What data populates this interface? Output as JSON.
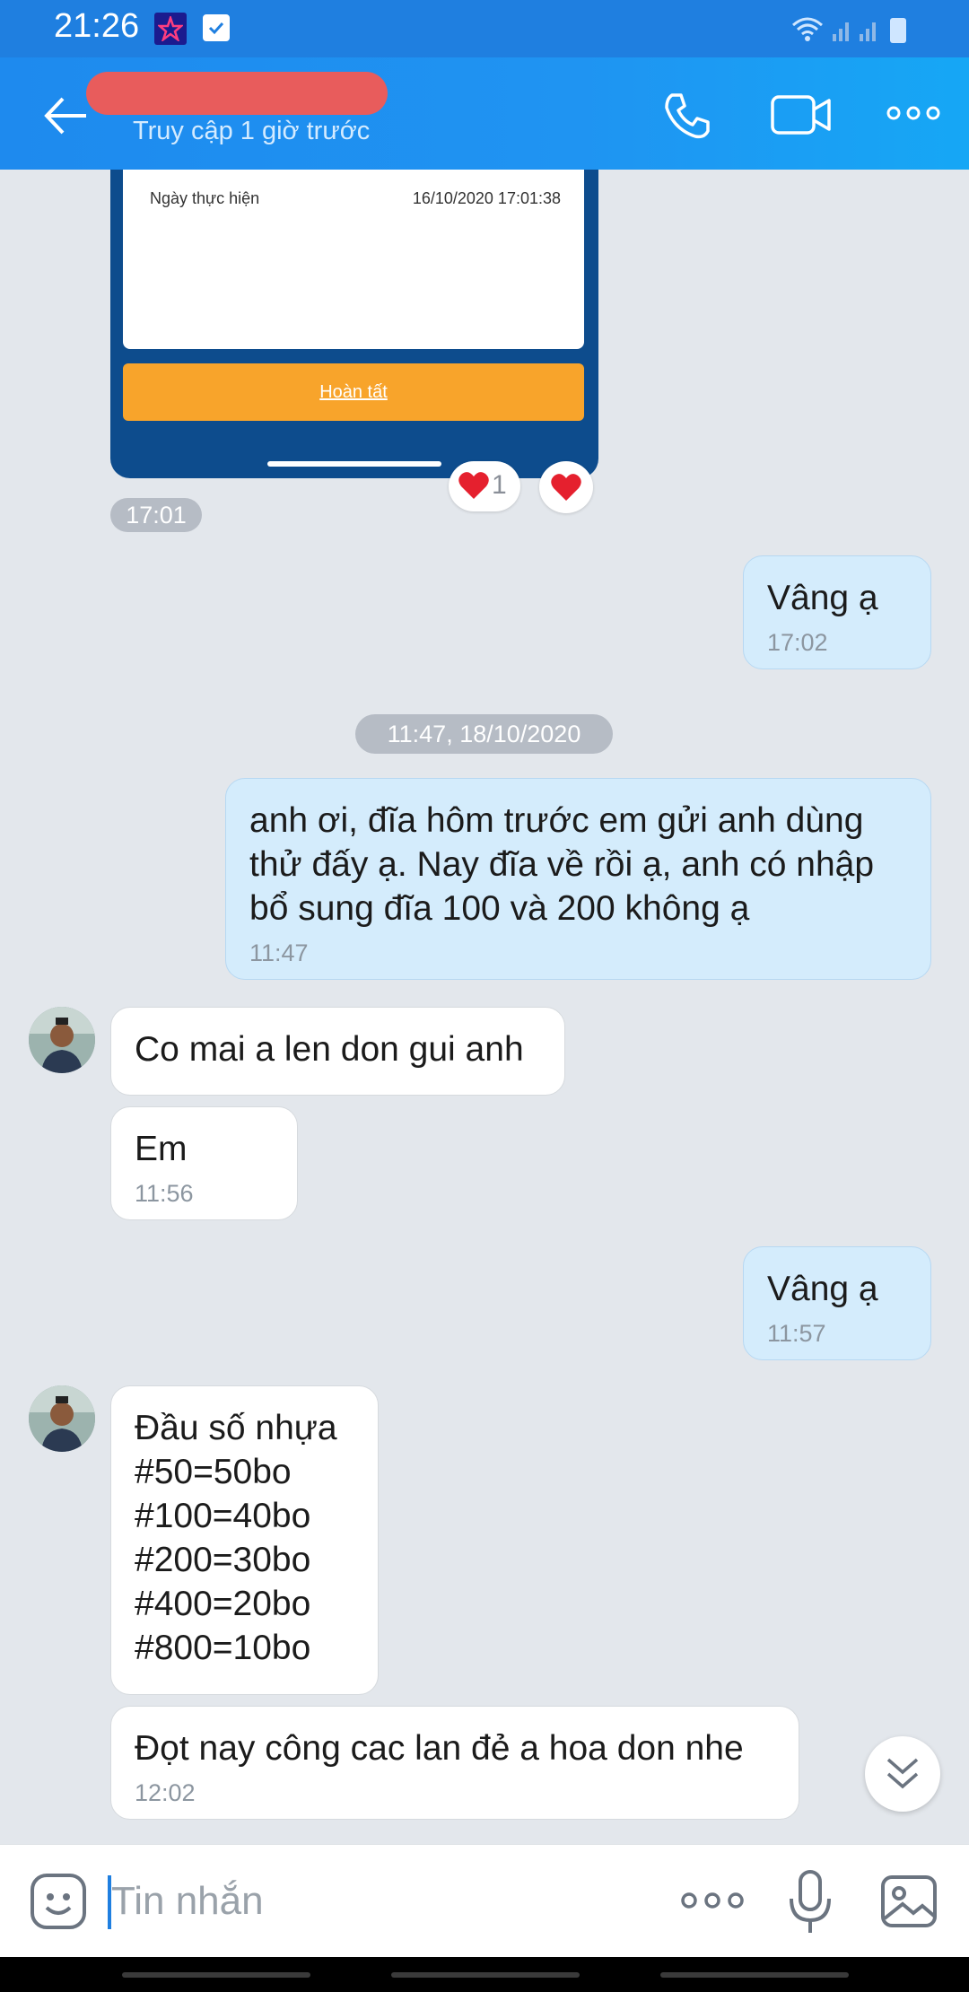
{
  "status_bar": {
    "time": "21:26"
  },
  "header": {
    "contact_status": "Truy cập 1 giờ trước",
    "icons": [
      "back-arrow-icon",
      "phone-icon",
      "video-icon",
      "more-icon"
    ]
  },
  "shared_image": {
    "receipt_label": "Ngày thực hiện",
    "receipt_value": "16/10/2020 17:01:38",
    "finish_label": "Hoàn tất"
  },
  "reactions": {
    "heart_count": "1"
  },
  "timestamps": {
    "image_time": "17:01",
    "date_divider": "11:47, 18/10/2020"
  },
  "messages": [
    {
      "dir": "out",
      "text": "Vâng ạ",
      "time": "17:02"
    },
    {
      "dir": "out",
      "text": "anh ơi, đĩa hôm trước em gửi anh dùng\nthử đấy ạ. Nay đĩa về rồi ạ, anh có nhập\nbổ sung đĩa 100 và 200 không ạ",
      "time": "11:47"
    },
    {
      "dir": "in",
      "text": "Co mai a len don gui anh",
      "time": ""
    },
    {
      "dir": "in",
      "text": "Em",
      "time": "11:56"
    },
    {
      "dir": "out",
      "text": "Vâng ạ",
      "time": "11:57"
    },
    {
      "dir": "in",
      "text": "Đầu số nhựa\n#50=50bo\n#100=40bo\n#200=30bo\n#400=20bo\n#800=10bo",
      "time": ""
    },
    {
      "dir": "in",
      "text": "Đọt nay công cac lan đẻ a hoa don nhe",
      "time": "12:02"
    }
  ],
  "input": {
    "placeholder": "Tin nhắn"
  },
  "colors": {
    "header": "#1f8ff0",
    "outgoing_bubble": "#d4ecfc",
    "background": "#e3e7ec"
  }
}
